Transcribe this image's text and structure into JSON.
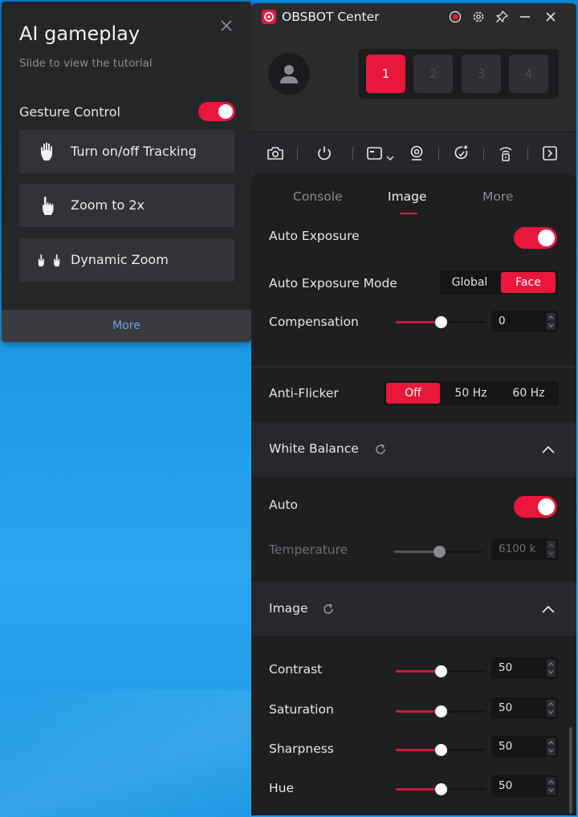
{
  "ai_panel": {
    "title": "AI gameplay",
    "subtitle": "Slide to view the tutorial",
    "gesture_control_label": "Gesture Control",
    "gesture_control_on": true,
    "gestures": [
      {
        "label": "Turn on/off Tracking",
        "icon": "open-palm-icon"
      },
      {
        "label": "Zoom to 2x",
        "icon": "pointing-hand-icon"
      },
      {
        "label": "Dynamic Zoom",
        "icon": "two-hands-icon"
      }
    ],
    "more_label": "More"
  },
  "window": {
    "title": "OBSBOT Center",
    "titlebar_icons": [
      "record-icon",
      "gear-icon",
      "pin-icon",
      "minimize-icon",
      "close-icon"
    ]
  },
  "devices": {
    "items": [
      "1",
      "2",
      "3",
      "4"
    ],
    "active": "1"
  },
  "toolbar": {
    "icons": [
      "camera-snapshot-icon",
      "power-icon",
      "video-mode-icon",
      "webcam-icon",
      "ai-tracking-icon",
      "remote-icon",
      "collapse-panel-icon"
    ]
  },
  "tabs": {
    "items": [
      "Console",
      "Image",
      "More"
    ],
    "active": "Image"
  },
  "exposure": {
    "auto_exposure_label": "Auto Exposure",
    "auto_exposure_on": true,
    "mode_label": "Auto Exposure Mode",
    "mode_options": [
      "Global",
      "Face"
    ],
    "mode_selected": "Face",
    "compensation_label": "Compensation",
    "compensation_value": "0",
    "compensation_fraction": 0.5
  },
  "anti_flicker": {
    "label": "Anti-Flicker",
    "options": [
      "Off",
      "50 Hz",
      "60 Hz"
    ],
    "selected": "Off"
  },
  "white_balance": {
    "header": "White Balance",
    "auto_label": "Auto",
    "auto_on": true,
    "temperature_label": "Temperature",
    "temperature_value": "6100 k",
    "temperature_fraction": 0.5
  },
  "image_section": {
    "header": "Image",
    "rows": [
      {
        "label": "Contrast",
        "value": "50",
        "fraction": 0.5
      },
      {
        "label": "Saturation",
        "value": "50",
        "fraction": 0.5
      },
      {
        "label": "Sharpness",
        "value": "50",
        "fraction": 0.5
      },
      {
        "label": "Hue",
        "value": "50",
        "fraction": 0.5
      }
    ]
  },
  "colors": {
    "accent": "#e8173b",
    "panel_bg": "#252628",
    "window_bg": "#2a2b2d",
    "content_bg": "#1e1f21",
    "link": "#6aa0e8"
  }
}
